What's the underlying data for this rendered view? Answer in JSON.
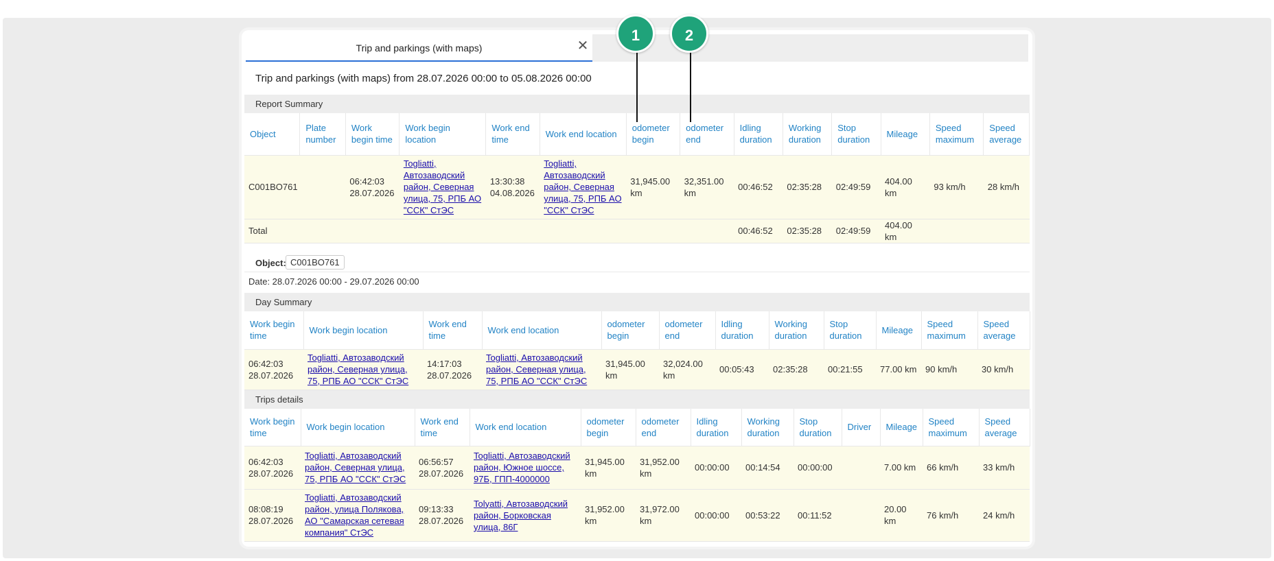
{
  "tab": {
    "label": "Trip and parkings (with maps)",
    "close": "✕"
  },
  "report_title": "Trip and parkings (with maps) from 28.07.2026 00:00 to 05.08.2026 00:00",
  "markers": [
    "1",
    "2"
  ],
  "report_summary": {
    "title": "Report Summary",
    "headers": [
      "Object",
      "Plate number",
      "Work begin time",
      "Work begin location",
      "Work end time",
      "Work end location",
      "odometer begin",
      "odometer end",
      "Idling duration",
      "Working duration",
      "Stop duration",
      "Mileage",
      "Speed maximum",
      "Speed average"
    ],
    "row": {
      "object": "C001BO761",
      "plate": "",
      "begin_time": "06:42:03 28.07.2026",
      "begin_location": "Togliatti, Автозаводский район, Северная улица, 75, РПБ АО \"ССК\" СтЭС",
      "end_time": "13:30:38 04.08.2026",
      "end_location": "Togliatti, Автозаводский район, Северная улица, 75, РПБ АО \"ССК\" СтЭС",
      "odo_begin": "31,945.00 km",
      "odo_end": "32,351.00 km",
      "idling": "00:46:52",
      "working": "02:35:28",
      "stop": "02:49:59",
      "mileage": "404.00 km",
      "speed_max": "93 km/h",
      "speed_avg": "28 km/h"
    },
    "total": {
      "label": "Total",
      "idling": "00:46:52",
      "working": "02:35:28",
      "stop": "02:49:59",
      "mileage": "404.00 km"
    }
  },
  "object_filter": {
    "label": "Object:",
    "value": "C001BO761"
  },
  "date_range": "Date: 28.07.2026 00:00 - 29.07.2026 00:00",
  "day_summary": {
    "title": "Day Summary",
    "headers": [
      "Work begin time",
      "Work begin location",
      "Work end time",
      "Work end location",
      "odometer begin",
      "odometer end",
      "Idling duration",
      "Working duration",
      "Stop duration",
      "Mileage",
      "Speed maximum",
      "Speed average"
    ],
    "row": {
      "begin_time": "06:42:03 28.07.2026",
      "begin_location": "Togliatti, Автозаводский район, Северная улица, 75, РПБ АО \"ССК\" СтЭС",
      "end_time": "14:17:03 28.07.2026",
      "end_location": "Togliatti, Автозаводский район, Северная улица, 75, РПБ АО \"ССК\" СтЭС",
      "odo_begin": "31,945.00 km",
      "odo_end": "32,024.00 km",
      "idling": "00:05:43",
      "working": "02:35:28",
      "stop": "00:21:55",
      "mileage": "77.00 km",
      "speed_max": "90 km/h",
      "speed_avg": "30 km/h"
    }
  },
  "trips_details": {
    "title": "Trips details",
    "headers": [
      "Work begin time",
      "Work begin location",
      "Work end time",
      "Work end location",
      "odometer begin",
      "odometer end",
      "Idling duration",
      "Working duration",
      "Stop duration",
      "Driver",
      "Mileage",
      "Speed maximum",
      "Speed average"
    ],
    "rows": [
      {
        "begin_time": "06:42:03 28.07.2026",
        "begin_location": "Togliatti, Автозаводский район, Северная улица, 75, РПБ АО \"ССК\" СтЭС",
        "end_time": "06:56:57 28.07.2026",
        "end_location": "Togliatti, Автозаводский район, Южное шоссе, 97Б, ГПП-4000000",
        "odo_begin": "31,945.00 km",
        "odo_end": "31,952.00 km",
        "idling": "00:00:00",
        "working": "00:14:54",
        "stop": "00:00:00",
        "driver": "",
        "mileage": "7.00 km",
        "speed_max": "66 km/h",
        "speed_avg": "33 km/h"
      },
      {
        "begin_time": "08:08:19 28.07.2026",
        "begin_location": "Togliatti, Автозаводский район, улица Полякова, АО \"Самарская сетевая компания\" СтЭС",
        "end_time": "09:13:33 28.07.2026",
        "end_location": "Tolyatti, Автозаводский район, Борковская улица, 86Г",
        "odo_begin": "31,952.00 km",
        "odo_end": "31,972.00 km",
        "idling": "00:00:00",
        "working": "00:53:22",
        "stop": "00:11:52",
        "driver": "",
        "mileage": "20.00 km",
        "speed_max": "76 km/h",
        "speed_avg": "24 km/h"
      }
    ]
  }
}
